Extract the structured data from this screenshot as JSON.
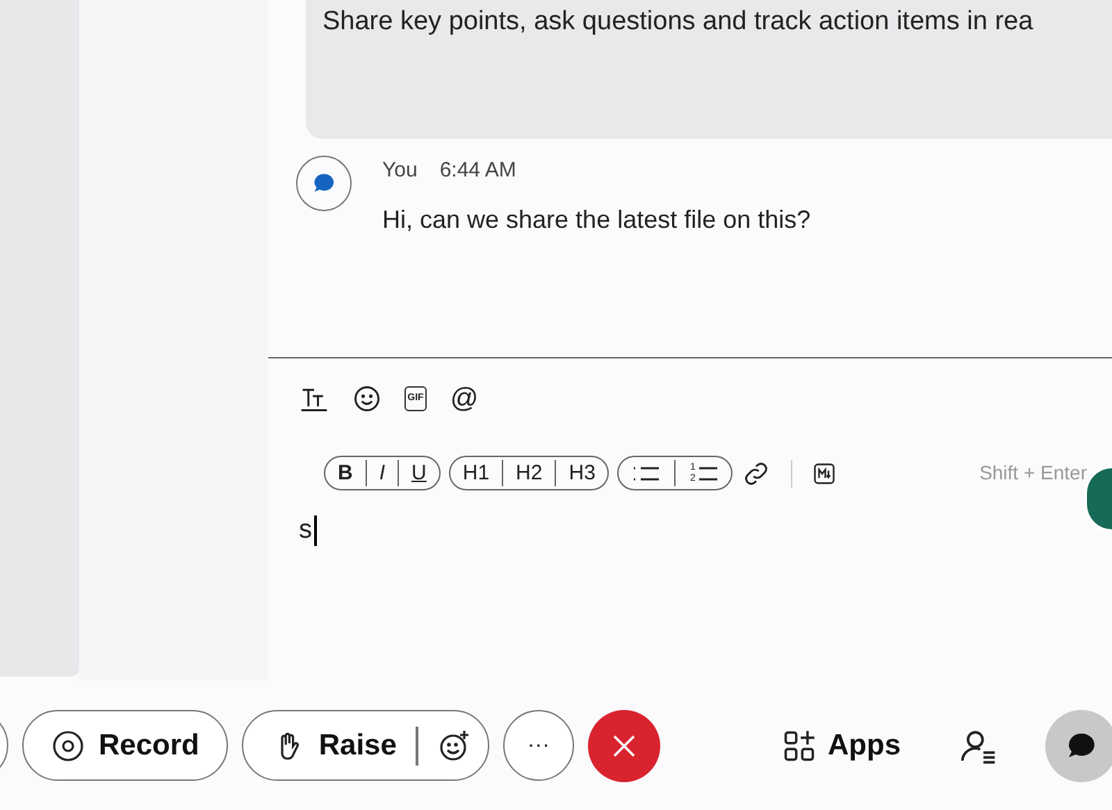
{
  "banner": {
    "text": "Share key points, ask questions and track action items in rea"
  },
  "messages": [
    {
      "sender": "You",
      "time": "6:44 AM",
      "text": "Hi, can we share the latest file on this?"
    }
  ],
  "composer_tools": [
    {
      "kind": "text-format"
    },
    {
      "kind": "emoji"
    },
    {
      "kind": "gif",
      "label": "GIF"
    },
    {
      "kind": "mention",
      "label": "@"
    }
  ],
  "format_groups": [
    [
      {
        "kind": "bold",
        "label": "B"
      },
      {
        "kind": "italic",
        "label": "I"
      },
      {
        "kind": "underline",
        "label": "U"
      }
    ],
    [
      {
        "kind": "text",
        "label": "H1"
      },
      {
        "kind": "text",
        "label": "H2"
      },
      {
        "kind": "text",
        "label": "H3"
      }
    ],
    [
      {
        "kind": "bullets"
      },
      {
        "kind": "numbered",
        "label": "1 2"
      }
    ]
  ],
  "hint": "Shift + Enter",
  "draft": "s",
  "controls": [
    {
      "kind": "partial"
    },
    {
      "kind": "record",
      "label": "Record"
    },
    {
      "kind": "raise",
      "label": "Raise"
    },
    {
      "kind": "more",
      "label": "···"
    },
    {
      "kind": "leave"
    },
    {
      "kind": "apps",
      "label": "Apps"
    },
    {
      "kind": "people"
    },
    {
      "kind": "chat",
      "selected": true
    }
  ]
}
